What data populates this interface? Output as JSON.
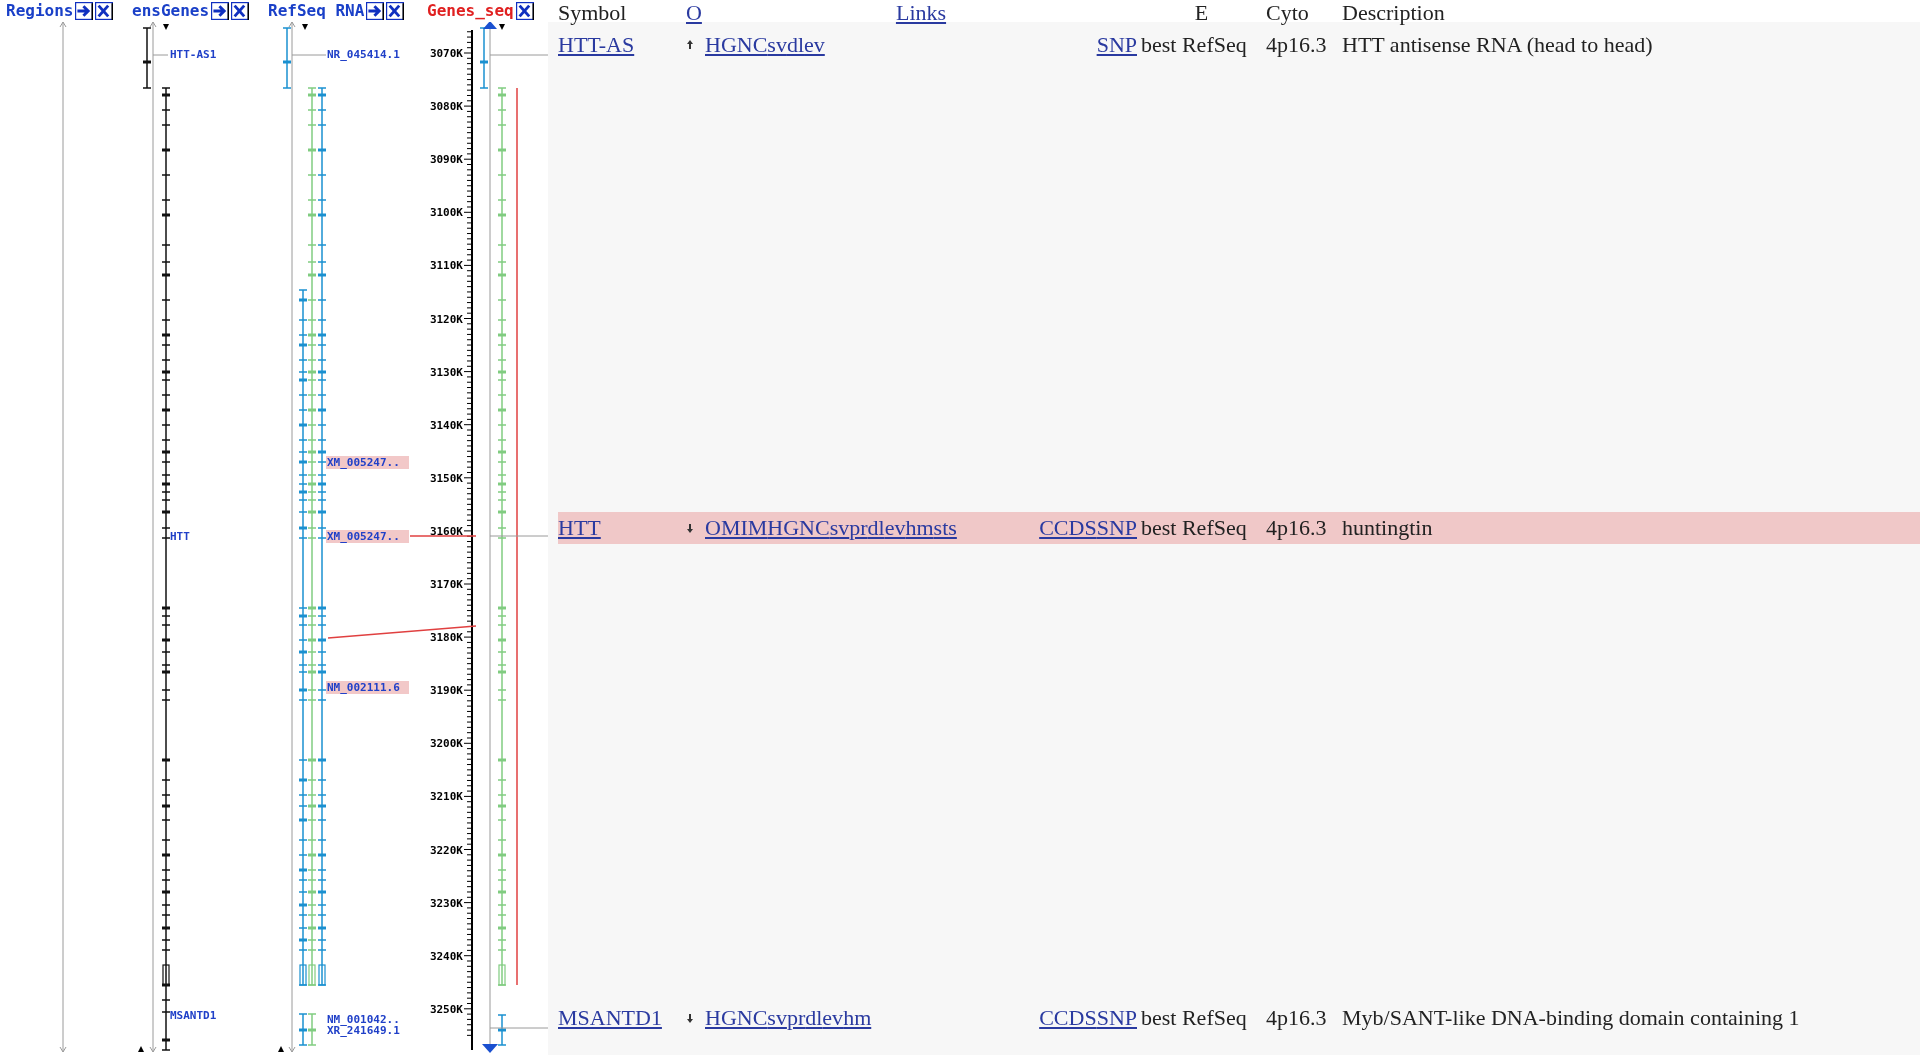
{
  "tracks": [
    {
      "label": "Regions",
      "arrow_button": true,
      "selected": false
    },
    {
      "label": "ensGenes",
      "arrow_button": true,
      "selected": false
    },
    {
      "label": "RefSeq RNA",
      "arrow_button": true,
      "selected": false
    },
    {
      "label": "Genes_seq",
      "arrow_button": false,
      "selected": true
    }
  ],
  "ensgenes_labels": [
    "HTT-AS1",
    "HTT",
    "MSANTD1"
  ],
  "refseq_labels": [
    {
      "text": "NR_045414.1",
      "highlighted": false
    },
    {
      "text": "XM_005247..",
      "highlighted": true
    },
    {
      "text": "XM_005247..",
      "highlighted": true
    },
    {
      "text": "NM_002111.6",
      "highlighted": true
    },
    {
      "text": "NM_001042..",
      "highlighted": false
    },
    {
      "text": "XR_241649.1",
      "highlighted": false
    }
  ],
  "ruler_labels": [
    "3070K",
    "3080K",
    "3090K",
    "3100K",
    "3110K",
    "3120K",
    "3130K",
    "3140K",
    "3150K",
    "3160K",
    "3170K",
    "3180K",
    "3190K",
    "3200K",
    "3210K",
    "3220K",
    "3230K",
    "3240K",
    "3250K"
  ],
  "table": {
    "columns": [
      {
        "label": "Symbol",
        "link": false
      },
      {
        "label": "O",
        "link": true
      },
      {
        "label": "Links",
        "link": true
      },
      {
        "label": "E",
        "link": false
      },
      {
        "label": "Cyto",
        "link": false
      },
      {
        "label": "Description",
        "link": false
      }
    ],
    "rows": [
      {
        "symbol": "HTT-AS",
        "kind": "up",
        "selected": false,
        "links": [
          "HGNC",
          "sv",
          "dl",
          "ev"
        ],
        "links_2": [
          "SNP"
        ],
        "evidence": "best RefSeq",
        "cyto": "4p16.3",
        "description": "HTT antisense RNA (head to head)"
      },
      {
        "symbol": "HTT",
        "kind": "down",
        "selected": true,
        "links": [
          "OMIM",
          "HGNC",
          "sv",
          "pr",
          "dl",
          "ev",
          "hm",
          "sts"
        ],
        "links_2": [
          "CCDS",
          "SNP"
        ],
        "evidence": "best RefSeq",
        "cyto": "4p16.3",
        "description": "huntingtin"
      },
      {
        "symbol": "MSANTD1",
        "kind": "down",
        "selected": false,
        "links": [
          "HGNC",
          "sv",
          "pr",
          "dl",
          "ev",
          "hm"
        ],
        "links_2": [
          "CCDS",
          "SNP"
        ],
        "evidence": "best RefSeq",
        "cyto": "4p16.3",
        "description": "Myb/SANT-like DNA-binding domain containing 1"
      }
    ]
  }
}
